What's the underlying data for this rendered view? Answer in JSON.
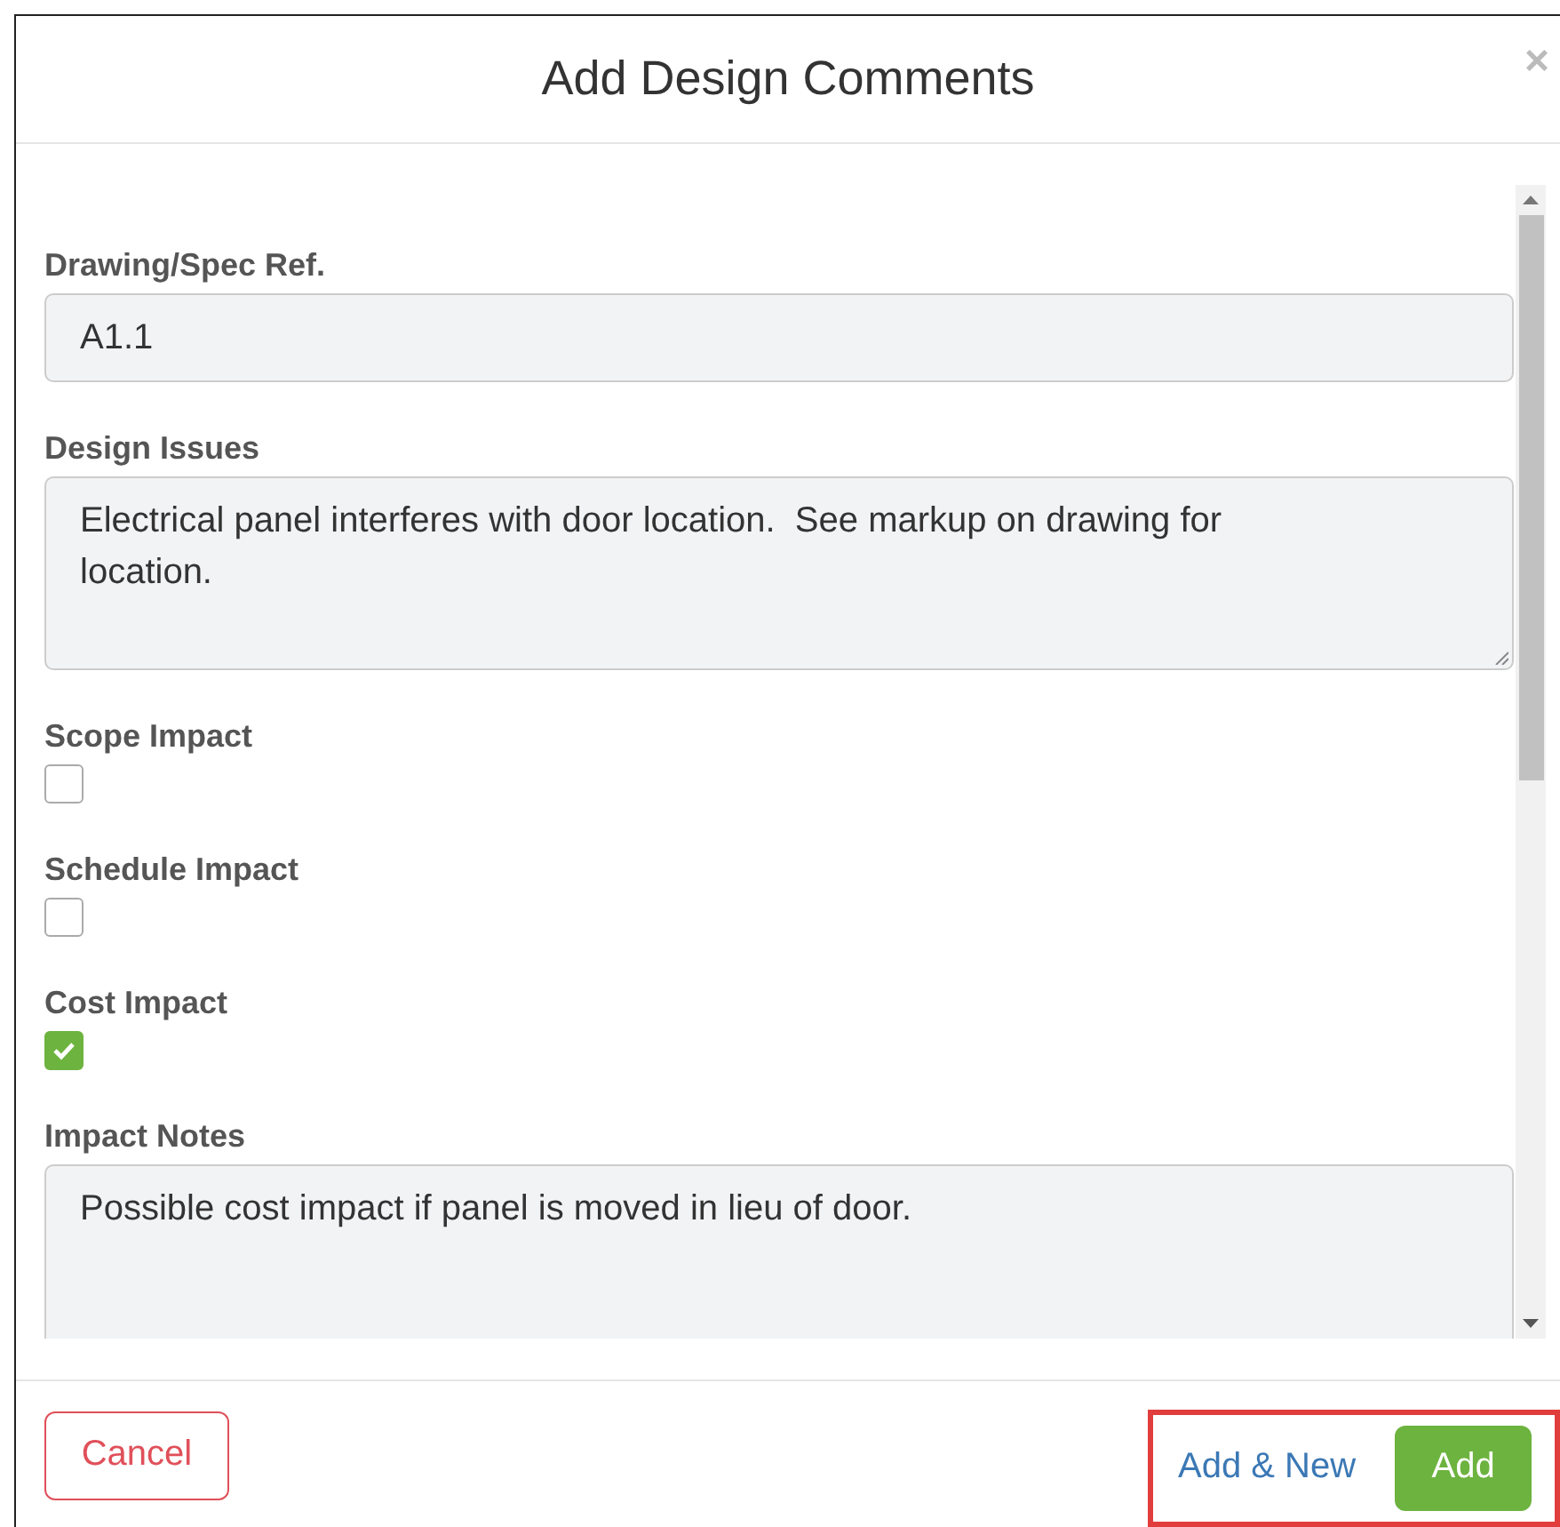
{
  "dialog": {
    "title": "Add Design Comments",
    "close": "×"
  },
  "fields": [
    {
      "kind": "text",
      "label": "Drawing/Spec Ref.",
      "value": "A1.1"
    },
    {
      "kind": "textarea",
      "label": "Design Issues",
      "value": "Electrical panel interferes with door location.  See markup on drawing for location."
    },
    {
      "kind": "checkbox",
      "label": "Scope Impact",
      "checked": false
    },
    {
      "kind": "checkbox",
      "label": "Schedule Impact",
      "checked": false
    },
    {
      "kind": "checkbox",
      "label": "Cost Impact",
      "checked": true
    },
    {
      "kind": "textarea",
      "label": "Impact Notes",
      "value": "Possible cost impact if panel is moved in lieu of door."
    }
  ],
  "footer": {
    "cancel": "Cancel",
    "add_new": "Add & New",
    "add": "Add"
  }
}
